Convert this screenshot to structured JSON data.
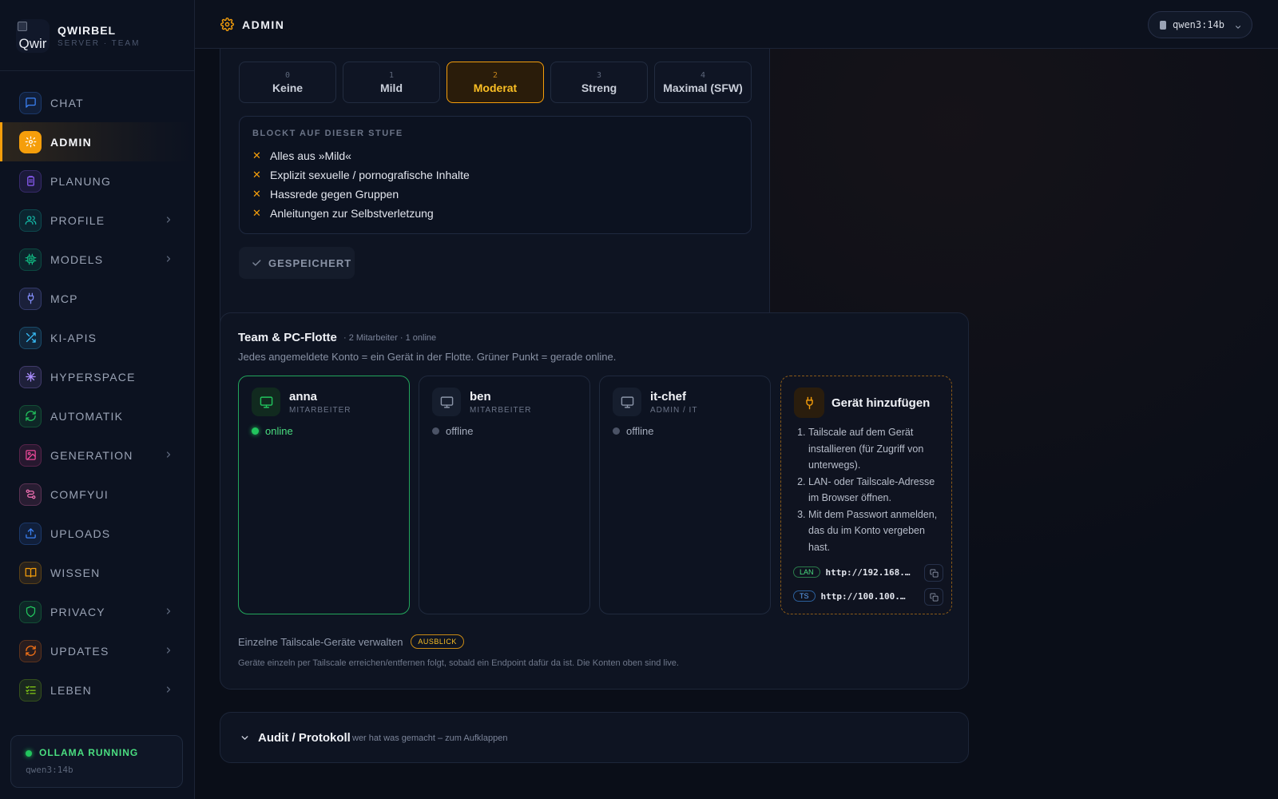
{
  "brand": {
    "name": "QWIRBEL",
    "subtitle": "SERVER · TEAM",
    "logo_alt": "Qwir"
  },
  "sidebar": {
    "items": [
      {
        "label": "CHAT",
        "icon": "chat-icon",
        "color": "#3b82f6",
        "has_chevron": false,
        "active": false
      },
      {
        "label": "ADMIN",
        "icon": "gear-icon",
        "color": "#f59e0b",
        "has_chevron": false,
        "active": true
      },
      {
        "label": "PLANUNG",
        "icon": "clipboard-icon",
        "color": "#8b5cf6",
        "has_chevron": false,
        "active": false
      },
      {
        "label": "PROFILE",
        "icon": "users-icon",
        "color": "#14b8a6",
        "has_chevron": true,
        "active": false
      },
      {
        "label": "MODELS",
        "icon": "chip-icon",
        "color": "#10b981",
        "has_chevron": true,
        "active": false
      },
      {
        "label": "MCP",
        "icon": "plug-icon",
        "color": "#818cf8",
        "has_chevron": false,
        "active": false
      },
      {
        "label": "KI-APIS",
        "icon": "shuffle-icon",
        "color": "#38bdf8",
        "has_chevron": false,
        "active": false
      },
      {
        "label": "HYPERSPACE",
        "icon": "sparkle-icon",
        "color": "#a78bfa",
        "has_chevron": false,
        "active": false
      },
      {
        "label": "AUTOMATIK",
        "icon": "refresh-icon",
        "color": "#22c55e",
        "has_chevron": false,
        "active": false
      },
      {
        "label": "GENERATION",
        "icon": "image-icon",
        "color": "#ec4899",
        "has_chevron": true,
        "active": false
      },
      {
        "label": "COMFYUI",
        "icon": "nodes-icon",
        "color": "#f472b6",
        "has_chevron": false,
        "active": false
      },
      {
        "label": "UPLOADS",
        "icon": "upload-icon",
        "color": "#3b82f6",
        "has_chevron": false,
        "active": false
      },
      {
        "label": "WISSEN",
        "icon": "book-icon",
        "color": "#f59e0b",
        "has_chevron": false,
        "active": false
      },
      {
        "label": "PRIVACY",
        "icon": "shield-icon",
        "color": "#22c55e",
        "has_chevron": true,
        "active": false
      },
      {
        "label": "UPDATES",
        "icon": "sync-icon",
        "color": "#f97316",
        "has_chevron": true,
        "active": false
      },
      {
        "label": "LEBEN",
        "icon": "checklist-icon",
        "color": "#84cc16",
        "has_chevron": true,
        "active": false
      }
    ],
    "status": {
      "title": "OLLAMA RUNNING",
      "model": "qwen3:14b"
    }
  },
  "header": {
    "title": "ADMIN",
    "model_select": {
      "value": "qwen3:14b"
    }
  },
  "filter": {
    "levels": [
      {
        "num": "0",
        "label": "Keine",
        "selected": false
      },
      {
        "num": "1",
        "label": "Mild",
        "selected": false
      },
      {
        "num": "2",
        "label": "Moderat",
        "selected": true
      },
      {
        "num": "3",
        "label": "Streng",
        "selected": false
      },
      {
        "num": "4",
        "label": "Maximal (SFW)",
        "selected": false
      }
    ],
    "block_title": "BLOCKT AUF DIESER STUFE",
    "blocked": [
      "Alles aus »Mild«",
      "Explizit sexuelle / pornografische Inhalte",
      "Hassrede gegen Gruppen",
      "Anleitungen zur Selbstverletzung"
    ],
    "saved_label": "GESPEICHERT"
  },
  "team": {
    "title": "Team & PC-Flotte",
    "meta": "· 2 Mitarbeiter · 1 online",
    "description": "Jedes angemeldete Konto = ein Gerät in der Flotte. Grüner Punkt = gerade online.",
    "devices": [
      {
        "name": "anna",
        "role": "MITARBEITER",
        "status": "online",
        "online": true
      },
      {
        "name": "ben",
        "role": "MITARBEITER",
        "status": "offline",
        "online": false
      },
      {
        "name": "it-chef",
        "role": "ADMIN / IT",
        "status": "offline",
        "online": false
      }
    ],
    "add_device": {
      "title": "Gerät hinzufügen",
      "steps": [
        "Tailscale auf dem Gerät installieren (für Zugriff von unterwegs).",
        "LAN- oder Tailscale-Adresse im Browser öffnen.",
        "Mit dem Passwort anmelden, das du im Konto vergeben hast."
      ],
      "addresses": [
        {
          "tag": "LAN",
          "url": "http://192.168.…"
        },
        {
          "tag": "TS",
          "url": "http://100.100.1…"
        }
      ]
    },
    "tailscale_manage": {
      "label": "Einzelne Tailscale-Geräte verwalten",
      "badge": "AUSBLICK",
      "note": "Geräte einzeln per Tailscale erreichen/entfernen folgt, sobald ein Endpoint dafür da ist. Die Konten oben sind live."
    }
  },
  "audit": {
    "title": "Audit / Protokoll",
    "subtitle": "wer hat was gemacht – zum Aufklappen"
  }
}
